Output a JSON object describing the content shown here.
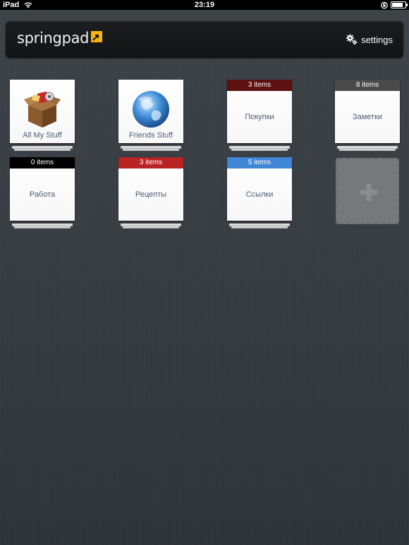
{
  "status_bar": {
    "carrier": "iPad",
    "time": "23:19",
    "battery_level": 0.85
  },
  "header": {
    "logo_text": "springpad",
    "settings_label": "settings",
    "brand_color": "#f5b50f"
  },
  "notebooks": [
    {
      "name": "All My Stuff",
      "icon": "box-icon"
    },
    {
      "name": "Friends Stuff",
      "icon": "globe-icon"
    },
    {
      "name": "Покупки",
      "items_label": "3 items",
      "band_color": "#5e0f0f"
    },
    {
      "name": "Заметки",
      "items_label": "8 items",
      "band_color": "#4a4a4a"
    },
    {
      "name": "Работа",
      "items_label": "0 items",
      "band_color": "#000000"
    },
    {
      "name": "Рецепты",
      "items_label": "3 items",
      "band_color": "#b82424"
    },
    {
      "name": "Ссылки",
      "items_label": "5 items",
      "band_color": "#3f86d6"
    }
  ],
  "add_notebook": {
    "icon": "plus-icon"
  }
}
